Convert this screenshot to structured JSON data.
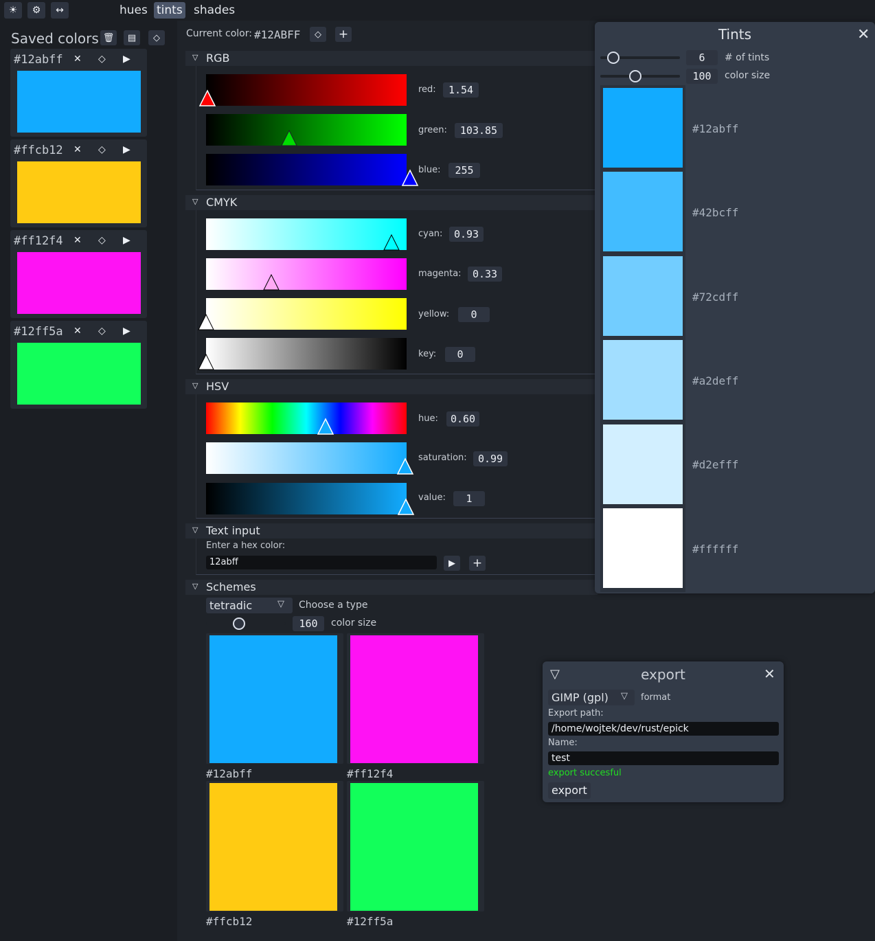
{
  "topbar": {
    "icons": [
      "sun-icon",
      "gear-icon",
      "swap-icon"
    ],
    "tabs": [
      {
        "label": "hues",
        "active": false
      },
      {
        "label": "tints",
        "active": true
      },
      {
        "label": "shades",
        "active": false
      }
    ]
  },
  "saved": {
    "title": "Saved colors",
    "items": [
      {
        "hex": "#12abff",
        "color": "#12abff"
      },
      {
        "hex": "#ffcb12",
        "color": "#ffcb12"
      },
      {
        "hex": "#ff12f4",
        "color": "#ff12f4"
      },
      {
        "hex": "#12ff5a",
        "color": "#12ff5a"
      }
    ]
  },
  "current": {
    "label": "Current color:",
    "hex": "#12ABFF"
  },
  "rgb": {
    "title": "RGB",
    "red": {
      "label": "red:",
      "value": "1.54"
    },
    "green": {
      "label": "green:",
      "value": "103.85"
    },
    "blue": {
      "label": "blue:",
      "value": "255"
    }
  },
  "cmyk": {
    "title": "CMYK",
    "cyan": {
      "label": "cyan:",
      "value": "0.93"
    },
    "magenta": {
      "label": "magenta:",
      "value": "0.33"
    },
    "yellow": {
      "label": "yellow:",
      "value": "0"
    },
    "key": {
      "label": "key:",
      "value": "0"
    }
  },
  "hsv": {
    "title": "HSV",
    "hue": {
      "label": "hue:",
      "value": "0.60"
    },
    "saturation": {
      "label": "saturation:",
      "value": "0.99"
    },
    "value": {
      "label": "value:",
      "value": "1"
    }
  },
  "text_input": {
    "title": "Text input",
    "prompt": "Enter a hex color:",
    "value": "12abff"
  },
  "schemes": {
    "title": "Schemes",
    "type": "tetradic",
    "type_label": "Choose a type",
    "size": "160",
    "size_label": "color size",
    "colors": [
      {
        "hex": "#12abff",
        "color": "#12abff"
      },
      {
        "hex": "#ff12f4",
        "color": "#ff12f4"
      },
      {
        "hex": "#ffcb12",
        "color": "#ffcb12"
      },
      {
        "hex": "#12ff5a",
        "color": "#12ff5a"
      }
    ]
  },
  "tints": {
    "title": "Tints",
    "count": "6",
    "count_label": "# of tints",
    "size": "100",
    "size_label": "color size",
    "items": [
      {
        "hex": "#12abff",
        "color": "#12abff"
      },
      {
        "hex": "#42bcff",
        "color": "#42bcff"
      },
      {
        "hex": "#72cdff",
        "color": "#72cdff"
      },
      {
        "hex": "#a2deff",
        "color": "#a2deff"
      },
      {
        "hex": "#d2efff",
        "color": "#d2efff"
      },
      {
        "hex": "#ffffff",
        "color": "#ffffff"
      }
    ]
  },
  "export": {
    "title": "export",
    "format": "GIMP (gpl)",
    "format_label": "format",
    "path_label": "Export path:",
    "path": "/home/wojtek/dev/rust/epick",
    "name_label": "Name:",
    "name": "test",
    "status": "export succesful",
    "button": "export"
  }
}
